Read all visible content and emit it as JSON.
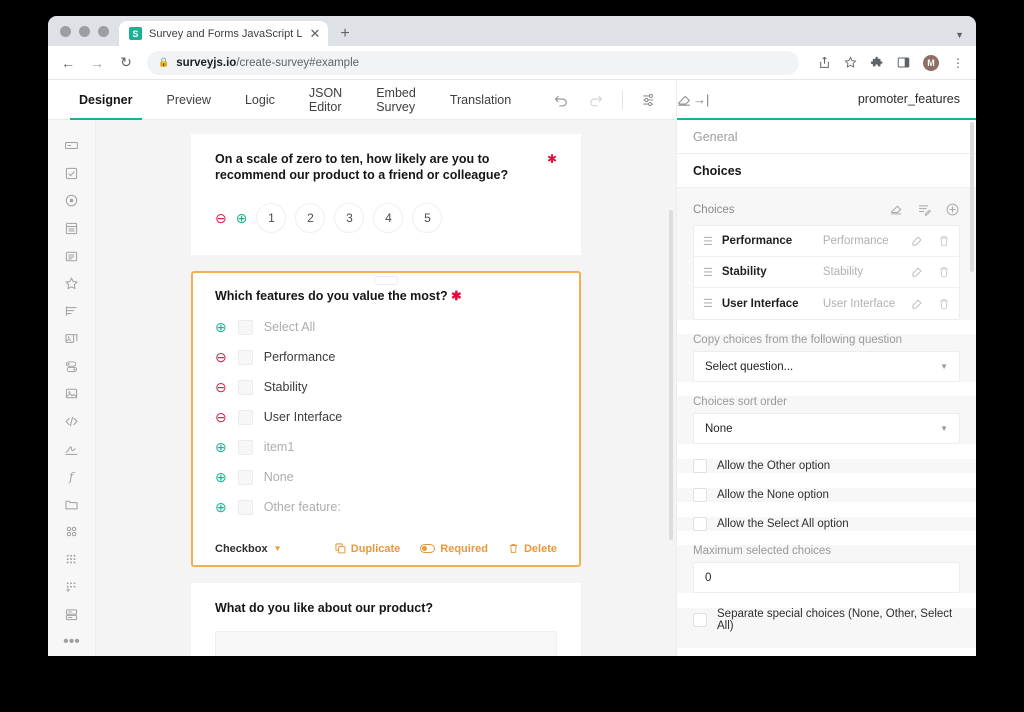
{
  "browser": {
    "tab": {
      "title": "Survey and Forms JavaScript L",
      "favicon_letter": "S",
      "close_icon": "close-icon"
    },
    "new_tab_label": "+",
    "tab_list_icon": "chevron-down-icon",
    "nav": {
      "back": "back-icon",
      "forward": "forward-icon",
      "reload": "reload-icon"
    },
    "url": {
      "lock_icon": "lock-icon",
      "domain": "surveyjs.io",
      "path": "/create-survey#example"
    },
    "actions": [
      "share-icon",
      "bookmark-star-icon",
      "extensions-puzzle-icon",
      "side-panel-icon"
    ],
    "profile_initial": "M",
    "menu_icon": "three-dot-menu-icon"
  },
  "app": {
    "tabs": [
      {
        "label": "Designer",
        "active": true
      },
      {
        "label": "Preview",
        "active": false
      },
      {
        "label": "Logic",
        "active": false
      },
      {
        "label": "JSON Editor",
        "active": false
      },
      {
        "label": "Embed Survey",
        "active": false
      },
      {
        "label": "Translation",
        "active": false
      }
    ],
    "toolbar_actions": [
      "undo-icon",
      "redo-icon",
      "survey-settings-icon",
      "clear-survey-icon"
    ],
    "accent_color": "#19b394",
    "selection_color": "#f0b152"
  },
  "toolbox": {
    "items": [
      "single-input-icon",
      "checkbox-icon",
      "radiogroup-icon",
      "dropdown-icon",
      "comment-icon",
      "rating-star-icon",
      "ranking-icon",
      "image-picker-icon",
      "boolean-toggle-icon",
      "image-icon",
      "html-code-icon",
      "signature-icon",
      "expression-icon",
      "file-icon",
      "matrix-icon",
      "matrix-dropdown-icon",
      "matrix-dynamic-icon",
      "panel-icon"
    ],
    "more_label": "•••"
  },
  "canvas": {
    "questions": [
      {
        "title": "On a scale of zero to ten, how likely are you to recommend our product to a friend or colleague?",
        "required": true,
        "type": "rating",
        "remove_icon": "remove-circle-icon",
        "add_icon": "add-circle-icon",
        "rates": [
          "1",
          "2",
          "3",
          "4",
          "5"
        ]
      },
      {
        "title": "Which features do you value the most?",
        "required": true,
        "selected": true,
        "choices": [
          {
            "label": "Select All",
            "ghost": true,
            "action": "add-circle-icon"
          },
          {
            "label": "Performance",
            "ghost": false,
            "action": "remove-circle-icon"
          },
          {
            "label": "Stability",
            "ghost": false,
            "action": "remove-circle-icon"
          },
          {
            "label": "User Interface",
            "ghost": false,
            "action": "remove-circle-icon"
          },
          {
            "label": "item1",
            "ghost": true,
            "action": "add-circle-icon"
          },
          {
            "label": "None",
            "ghost": true,
            "action": "add-circle-icon"
          },
          {
            "label": "Other feature:",
            "ghost": true,
            "action": "add-circle-icon"
          }
        ],
        "footer": {
          "type_label": "Checkbox",
          "duplicate_label": "Duplicate",
          "required_label": "Required",
          "delete_label": "Delete"
        }
      },
      {
        "title": "What do you like about our product?",
        "required": false,
        "type": "comment"
      }
    ]
  },
  "properties": {
    "collapse_icon": "collapse-panel-icon",
    "title": "promoter_features",
    "accordions": [
      {
        "label": "General",
        "active": false
      },
      {
        "label": "Choices",
        "active": true
      }
    ],
    "choices_section": {
      "title": "Choices",
      "header_icons": [
        "clear-icon",
        "bulk-edit-icon",
        "add-icon"
      ],
      "rows": [
        {
          "value": "Performance",
          "placeholder": "Performance",
          "edit_icon": "pencil-icon",
          "delete_icon": "trash-icon"
        },
        {
          "value": "Stability",
          "placeholder": "Stability",
          "edit_icon": "pencil-icon",
          "delete_icon": "trash-icon"
        },
        {
          "value": "User Interface",
          "placeholder": "User Interface",
          "edit_icon": "pencil-icon",
          "delete_icon": "trash-icon"
        }
      ]
    },
    "copy_choices": {
      "label": "Copy choices from the following question",
      "value": "Select question..."
    },
    "sort_order": {
      "label": "Choices sort order",
      "value": "None"
    },
    "checkboxes": [
      {
        "label": "Allow the Other option",
        "checked": false
      },
      {
        "label": "Allow the None option",
        "checked": false
      },
      {
        "label": "Allow the Select All option",
        "checked": false
      }
    ],
    "max_selected": {
      "label": "Maximum selected choices",
      "value": "0"
    },
    "separate_special": {
      "label": "Separate special choices (None, Other, Select All)",
      "checked": false
    }
  }
}
